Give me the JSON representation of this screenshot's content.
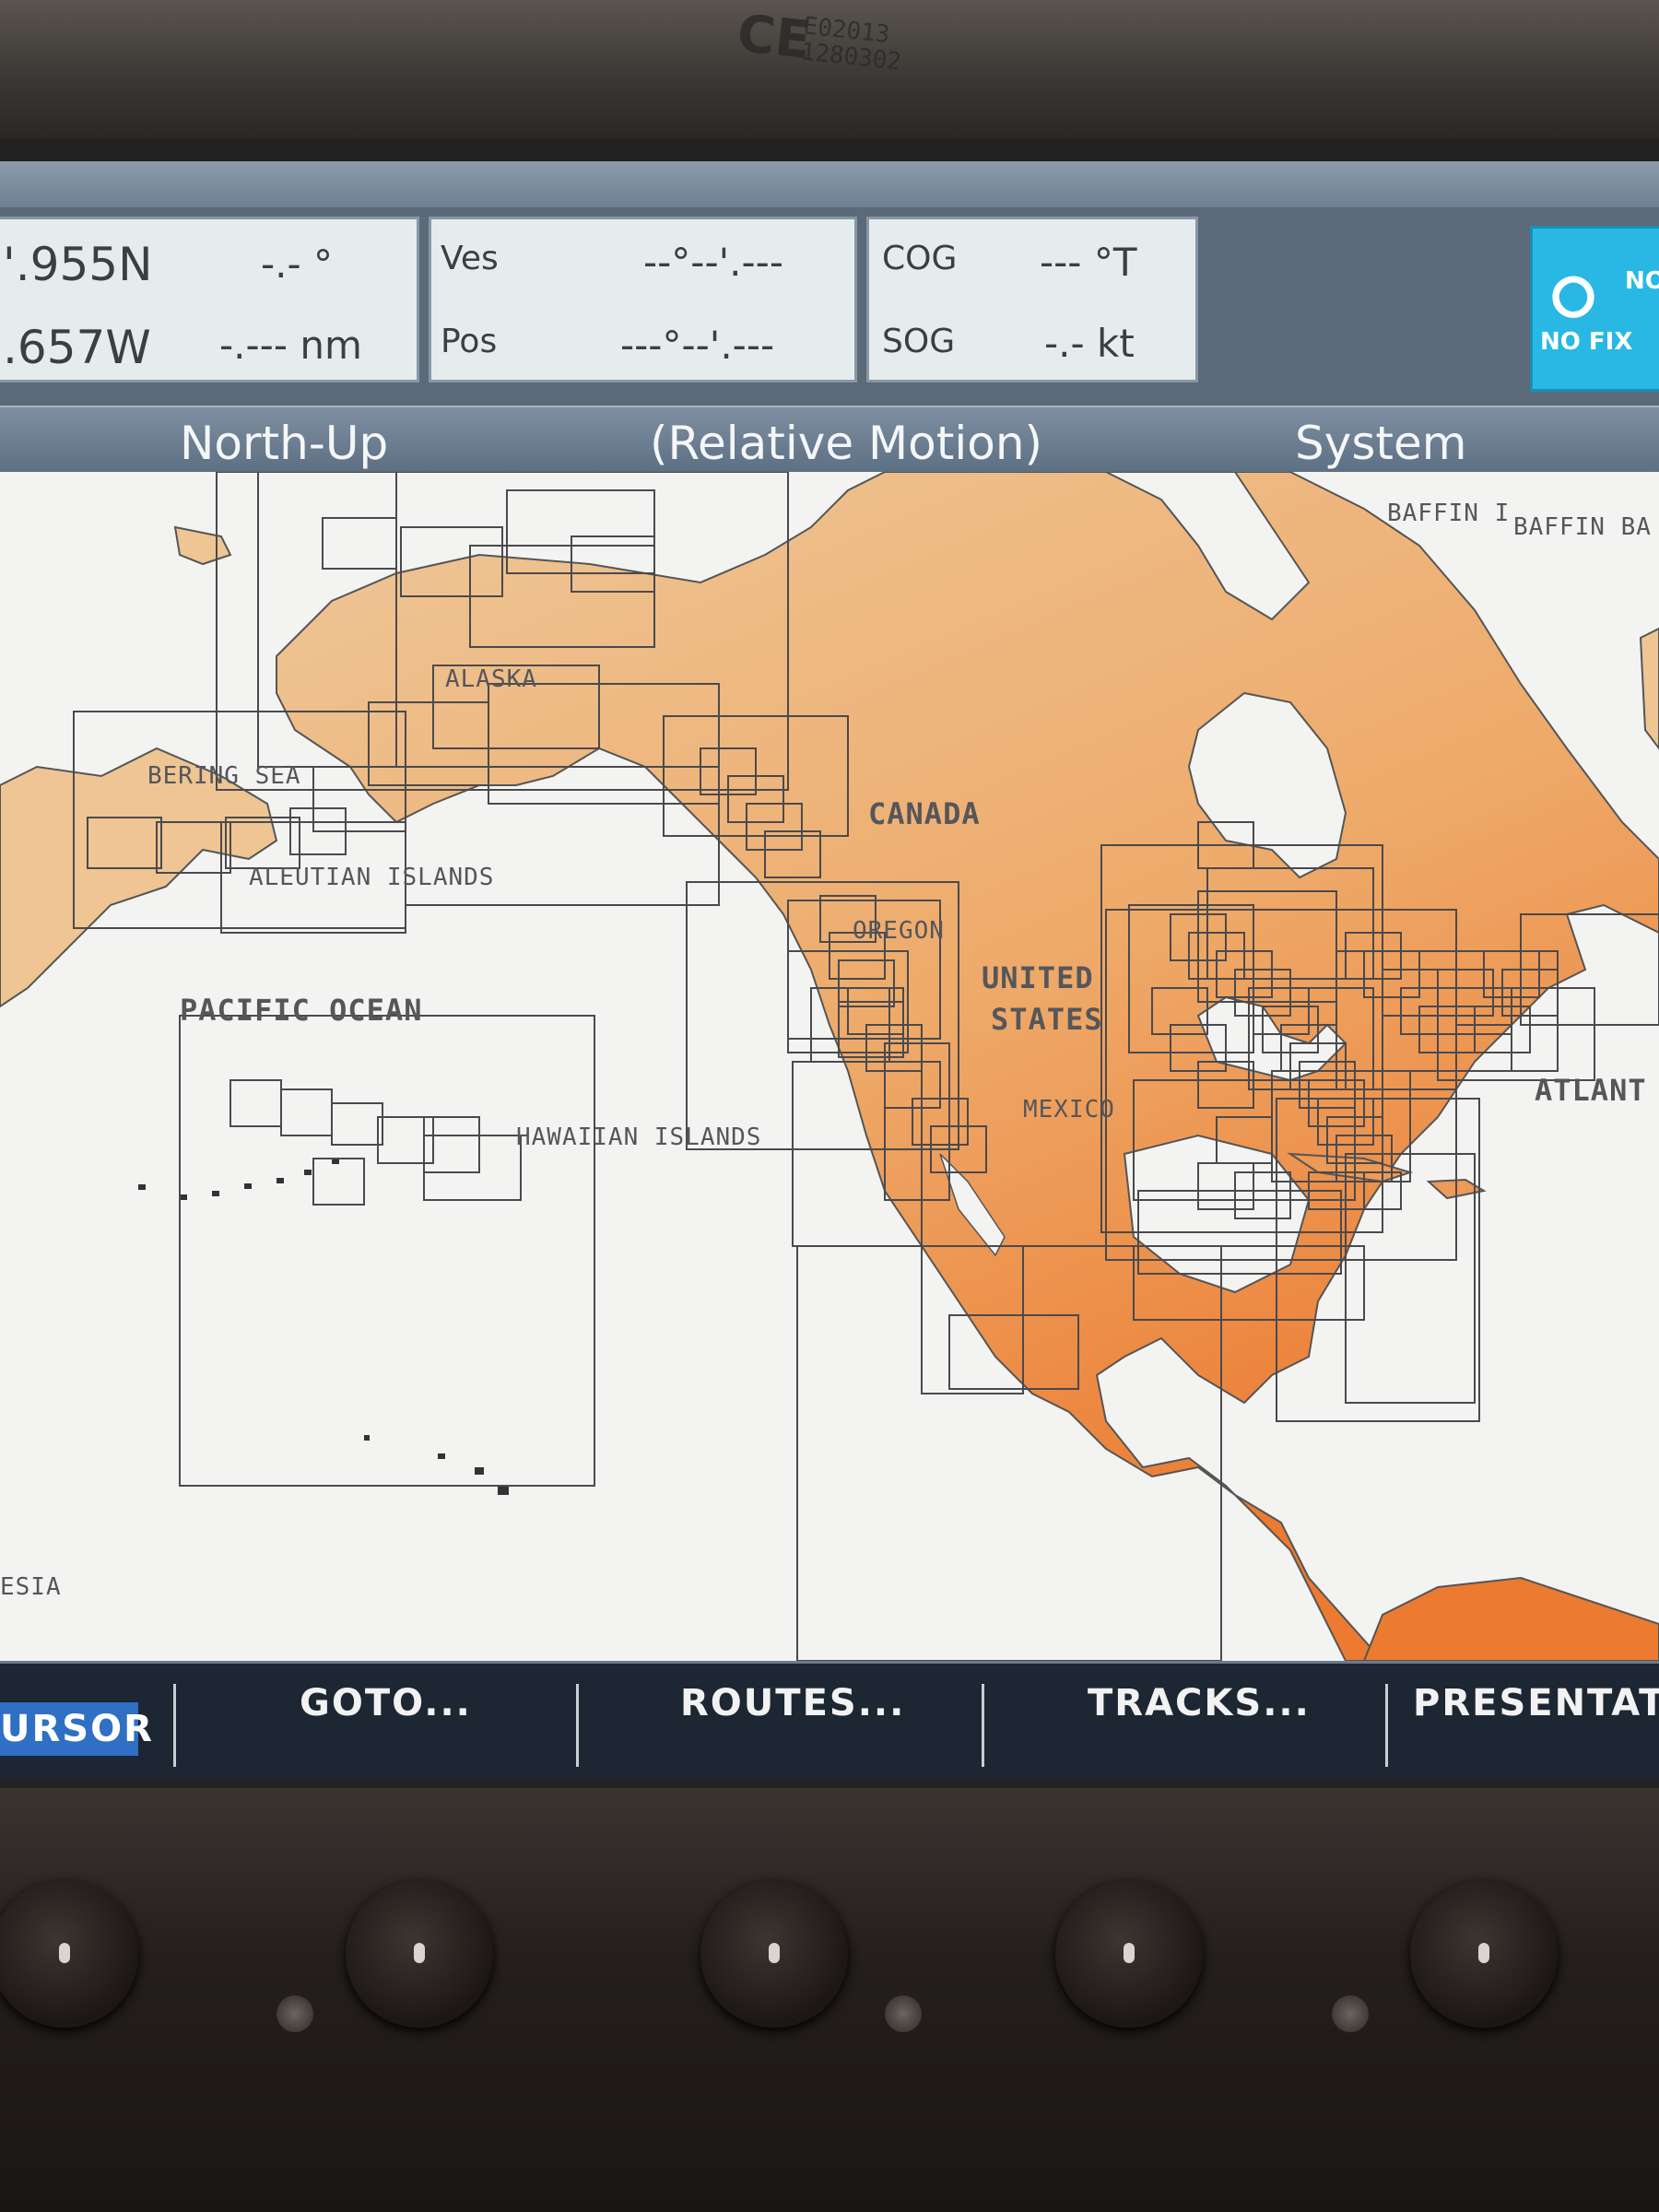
{
  "device": {
    "ce_mark": "CE",
    "cert_code_1": "E02013",
    "cert_code_2": "1280302"
  },
  "data_panels": {
    "cursor_lat": "'.955N",
    "cursor_lon": ".657W",
    "cursor_brg": "-.- °",
    "cursor_rng": "-.--- nm",
    "ves_label": "Ves",
    "pos_label": "Pos",
    "ves_lat": "--°--'.---",
    "ves_lon": "---°--'.---",
    "cog_label": "COG",
    "sog_label": "SOG",
    "cog_value": "--- °T",
    "sog_value": "-.- kt"
  },
  "gps_status": {
    "text": "NO FIX",
    "partial_label": "NO"
  },
  "mode_bar": {
    "orientation": "North-Up",
    "motion": "(Relative Motion)",
    "datum": "System"
  },
  "map_labels": {
    "alaska": "ALASKA",
    "bering_sea": "BERING SEA",
    "aleutian": "ALEUTIAN ISLANDS",
    "canada": "CANADA",
    "oregon": "OREGON",
    "united": "UNITED",
    "states": "STATES",
    "pacific": "PACIFIC OCEAN",
    "hawaiian": "HAWAIIAN ISLANDS",
    "mexico": "MEXICO",
    "atlantic": "ATLANT",
    "baffin1": "BAFFIN I",
    "baffin2": "BAFFIN BA",
    "indonesia": "ESIA"
  },
  "softkeys": {
    "cursor": "URSOR",
    "goto": "GOTO...",
    "routes": "ROUTES...",
    "tracks": "TRACKS...",
    "presentation": "PRESENTATI"
  },
  "colors": {
    "land_light": "#eec38e",
    "land_dark": "#ec8a3e",
    "sea": "#f3f4f2",
    "chart_lines": "#4a4a4e",
    "nofix_bg": "#29b8e4",
    "softbar_bg": "#1d2733",
    "modebar_bg": "#6f8194"
  }
}
